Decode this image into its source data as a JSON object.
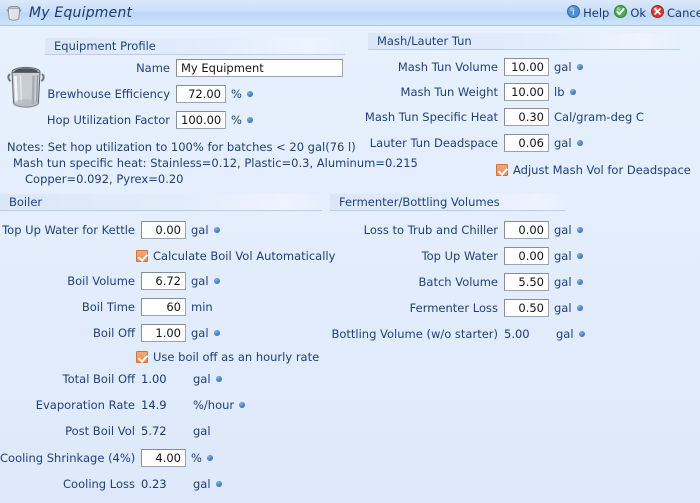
{
  "window": {
    "title": "My Equipment",
    "icon": "kettle-icon"
  },
  "toolbar": {
    "help": "Help",
    "ok": "Ok",
    "cancel": "Cancel"
  },
  "sections": {
    "equipment_profile": {
      "title": "Equipment Profile",
      "fields": {
        "name": {
          "label": "Name",
          "value": "My Equipment"
        },
        "brewhouse_efficiency": {
          "label": "Brewhouse Efficiency",
          "value": "72.00",
          "unit": "%"
        },
        "hop_utilization": {
          "label": "Hop Utilization Factor",
          "value": "100.00",
          "unit": "%"
        }
      }
    },
    "notes": {
      "line1": "Notes: Set hop utilization to 100% for batches < 20 gal(76 l)",
      "line2": "Mash tun specific heat: Stainless=0.12, Plastic=0.3, Aluminum=0.215",
      "line3": "Copper=0.092, Pyrex=0.20"
    },
    "mash_lauter_tun": {
      "title": "Mash/Lauter Tun",
      "fields": {
        "mash_tun_volume": {
          "label": "Mash Tun Volume",
          "value": "10.00",
          "unit": "gal"
        },
        "mash_tun_weight": {
          "label": "Mash Tun Weight",
          "value": "10.00",
          "unit": "lb"
        },
        "mash_tun_specific_heat": {
          "label": "Mash Tun Specific Heat",
          "value": "0.30",
          "unit": "Cal/gram-deg C"
        },
        "lauter_tun_deadspace": {
          "label": "Lauter Tun Deadspace",
          "value": "0.06",
          "unit": "gal"
        }
      },
      "checkbox_adjust_mash_vol": {
        "label": "Adjust Mash Vol for Deadspace",
        "checked": true
      }
    },
    "boiler": {
      "title": "Boiler",
      "fields": {
        "top_up_water_kettle": {
          "label": "Top Up Water for Kettle",
          "value": "0.00",
          "unit": "gal"
        },
        "boil_volume": {
          "label": "Boil Volume",
          "value": "6.72",
          "unit": "gal"
        },
        "boil_time": {
          "label": "Boil Time",
          "value": "60",
          "unit": "min"
        },
        "boil_off": {
          "label": "Boil Off",
          "value": "1.00",
          "unit": "gal"
        },
        "total_boil_off": {
          "label": "Total Boil Off",
          "value": "1.00",
          "unit": "gal"
        },
        "evaporation_rate": {
          "label": "Evaporation Rate",
          "value": "14.9",
          "unit": "%/hour"
        },
        "post_boil_vol": {
          "label": "Post Boil Vol",
          "value": "5.72",
          "unit": "gal"
        },
        "cooling_shrinkage": {
          "label": "Cooling Shrinkage (4%)",
          "value": "4.00",
          "unit": "%"
        },
        "cooling_loss": {
          "label": "Cooling Loss",
          "value": "0.23",
          "unit": "gal"
        }
      },
      "checkbox_calculate_boil_vol": {
        "label": "Calculate Boil Vol Automatically",
        "checked": true
      },
      "checkbox_hourly_rate": {
        "label": "Use boil off as an hourly rate",
        "checked": true
      }
    },
    "fermenter_bottling": {
      "title": "Fermenter/Bottling Volumes",
      "fields": {
        "loss_to_trub": {
          "label": "Loss to Trub and Chiller",
          "value": "0.00",
          "unit": "gal"
        },
        "top_up_water": {
          "label": "Top Up Water",
          "value": "0.00",
          "unit": "gal"
        },
        "batch_volume": {
          "label": "Batch Volume",
          "value": "5.50",
          "unit": "gal"
        },
        "fermenter_loss": {
          "label": "Fermenter Loss",
          "value": "0.50",
          "unit": "gal"
        },
        "bottling_volume": {
          "label": "Bottling Volume (w/o starter)",
          "value": "5.00",
          "unit": "gal"
        }
      }
    }
  },
  "colors": {
    "background": "#e2ecfb",
    "titlebar": "#c9defa",
    "label_text": "#22417a",
    "checkbox": "#ec8d52",
    "accent_dot": "#4b7fc4"
  }
}
